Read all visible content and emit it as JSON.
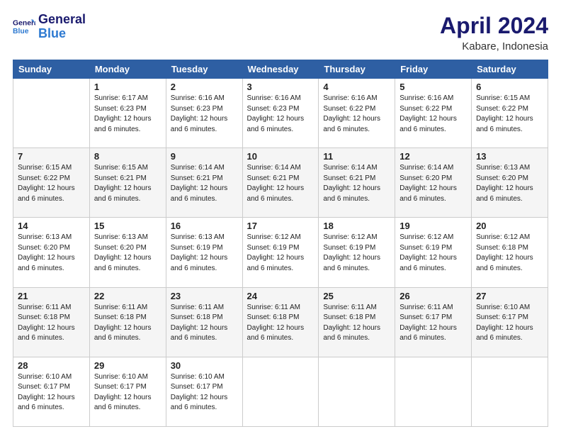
{
  "header": {
    "logo_line1": "General",
    "logo_line2": "Blue",
    "title": "April 2024",
    "location": "Kabare, Indonesia"
  },
  "days_of_week": [
    "Sunday",
    "Monday",
    "Tuesday",
    "Wednesday",
    "Thursday",
    "Friday",
    "Saturday"
  ],
  "weeks": [
    [
      {
        "day": "",
        "sunrise": "",
        "sunset": "",
        "daylight": ""
      },
      {
        "day": "1",
        "sunrise": "Sunrise: 6:17 AM",
        "sunset": "Sunset: 6:23 PM",
        "daylight": "Daylight: 12 hours and 6 minutes."
      },
      {
        "day": "2",
        "sunrise": "Sunrise: 6:16 AM",
        "sunset": "Sunset: 6:23 PM",
        "daylight": "Daylight: 12 hours and 6 minutes."
      },
      {
        "day": "3",
        "sunrise": "Sunrise: 6:16 AM",
        "sunset": "Sunset: 6:23 PM",
        "daylight": "Daylight: 12 hours and 6 minutes."
      },
      {
        "day": "4",
        "sunrise": "Sunrise: 6:16 AM",
        "sunset": "Sunset: 6:22 PM",
        "daylight": "Daylight: 12 hours and 6 minutes."
      },
      {
        "day": "5",
        "sunrise": "Sunrise: 6:16 AM",
        "sunset": "Sunset: 6:22 PM",
        "daylight": "Daylight: 12 hours and 6 minutes."
      },
      {
        "day": "6",
        "sunrise": "Sunrise: 6:15 AM",
        "sunset": "Sunset: 6:22 PM",
        "daylight": "Daylight: 12 hours and 6 minutes."
      }
    ],
    [
      {
        "day": "7",
        "sunrise": "Sunrise: 6:15 AM",
        "sunset": "Sunset: 6:22 PM",
        "daylight": "Daylight: 12 hours and 6 minutes."
      },
      {
        "day": "8",
        "sunrise": "Sunrise: 6:15 AM",
        "sunset": "Sunset: 6:21 PM",
        "daylight": "Daylight: 12 hours and 6 minutes."
      },
      {
        "day": "9",
        "sunrise": "Sunrise: 6:14 AM",
        "sunset": "Sunset: 6:21 PM",
        "daylight": "Daylight: 12 hours and 6 minutes."
      },
      {
        "day": "10",
        "sunrise": "Sunrise: 6:14 AM",
        "sunset": "Sunset: 6:21 PM",
        "daylight": "Daylight: 12 hours and 6 minutes."
      },
      {
        "day": "11",
        "sunrise": "Sunrise: 6:14 AM",
        "sunset": "Sunset: 6:21 PM",
        "daylight": "Daylight: 12 hours and 6 minutes."
      },
      {
        "day": "12",
        "sunrise": "Sunrise: 6:14 AM",
        "sunset": "Sunset: 6:20 PM",
        "daylight": "Daylight: 12 hours and 6 minutes."
      },
      {
        "day": "13",
        "sunrise": "Sunrise: 6:13 AM",
        "sunset": "Sunset: 6:20 PM",
        "daylight": "Daylight: 12 hours and 6 minutes."
      }
    ],
    [
      {
        "day": "14",
        "sunrise": "Sunrise: 6:13 AM",
        "sunset": "Sunset: 6:20 PM",
        "daylight": "Daylight: 12 hours and 6 minutes."
      },
      {
        "day": "15",
        "sunrise": "Sunrise: 6:13 AM",
        "sunset": "Sunset: 6:20 PM",
        "daylight": "Daylight: 12 hours and 6 minutes."
      },
      {
        "day": "16",
        "sunrise": "Sunrise: 6:13 AM",
        "sunset": "Sunset: 6:19 PM",
        "daylight": "Daylight: 12 hours and 6 minutes."
      },
      {
        "day": "17",
        "sunrise": "Sunrise: 6:12 AM",
        "sunset": "Sunset: 6:19 PM",
        "daylight": "Daylight: 12 hours and 6 minutes."
      },
      {
        "day": "18",
        "sunrise": "Sunrise: 6:12 AM",
        "sunset": "Sunset: 6:19 PM",
        "daylight": "Daylight: 12 hours and 6 minutes."
      },
      {
        "day": "19",
        "sunrise": "Sunrise: 6:12 AM",
        "sunset": "Sunset: 6:19 PM",
        "daylight": "Daylight: 12 hours and 6 minutes."
      },
      {
        "day": "20",
        "sunrise": "Sunrise: 6:12 AM",
        "sunset": "Sunset: 6:18 PM",
        "daylight": "Daylight: 12 hours and 6 minutes."
      }
    ],
    [
      {
        "day": "21",
        "sunrise": "Sunrise: 6:11 AM",
        "sunset": "Sunset: 6:18 PM",
        "daylight": "Daylight: 12 hours and 6 minutes."
      },
      {
        "day": "22",
        "sunrise": "Sunrise: 6:11 AM",
        "sunset": "Sunset: 6:18 PM",
        "daylight": "Daylight: 12 hours and 6 minutes."
      },
      {
        "day": "23",
        "sunrise": "Sunrise: 6:11 AM",
        "sunset": "Sunset: 6:18 PM",
        "daylight": "Daylight: 12 hours and 6 minutes."
      },
      {
        "day": "24",
        "sunrise": "Sunrise: 6:11 AM",
        "sunset": "Sunset: 6:18 PM",
        "daylight": "Daylight: 12 hours and 6 minutes."
      },
      {
        "day": "25",
        "sunrise": "Sunrise: 6:11 AM",
        "sunset": "Sunset: 6:18 PM",
        "daylight": "Daylight: 12 hours and 6 minutes."
      },
      {
        "day": "26",
        "sunrise": "Sunrise: 6:11 AM",
        "sunset": "Sunset: 6:17 PM",
        "daylight": "Daylight: 12 hours and 6 minutes."
      },
      {
        "day": "27",
        "sunrise": "Sunrise: 6:10 AM",
        "sunset": "Sunset: 6:17 PM",
        "daylight": "Daylight: 12 hours and 6 minutes."
      }
    ],
    [
      {
        "day": "28",
        "sunrise": "Sunrise: 6:10 AM",
        "sunset": "Sunset: 6:17 PM",
        "daylight": "Daylight: 12 hours and 6 minutes."
      },
      {
        "day": "29",
        "sunrise": "Sunrise: 6:10 AM",
        "sunset": "Sunset: 6:17 PM",
        "daylight": "Daylight: 12 hours and 6 minutes."
      },
      {
        "day": "30",
        "sunrise": "Sunrise: 6:10 AM",
        "sunset": "Sunset: 6:17 PM",
        "daylight": "Daylight: 12 hours and 6 minutes."
      },
      {
        "day": "",
        "sunrise": "",
        "sunset": "",
        "daylight": ""
      },
      {
        "day": "",
        "sunrise": "",
        "sunset": "",
        "daylight": ""
      },
      {
        "day": "",
        "sunrise": "",
        "sunset": "",
        "daylight": ""
      },
      {
        "day": "",
        "sunrise": "",
        "sunset": "",
        "daylight": ""
      }
    ]
  ]
}
